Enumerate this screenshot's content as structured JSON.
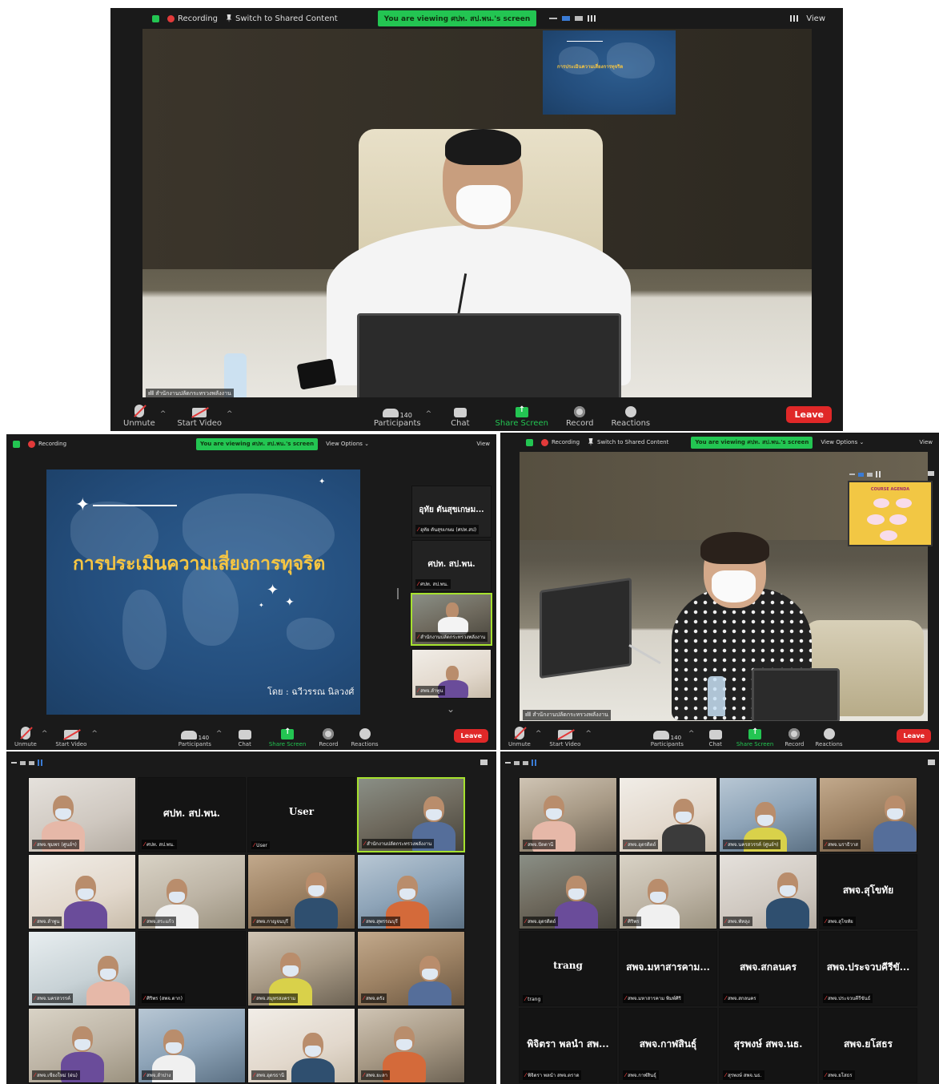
{
  "common": {
    "recording": "Recording",
    "switch_shared": "Switch to Shared Content",
    "banner": "You are viewing ศปท. สป.พน.'s screen",
    "view_options": "View Options ⌄",
    "view": "View",
    "toolbar": {
      "unmute": "Unmute",
      "start_video": "Start Video",
      "participants": "Participants",
      "participants_count": "140",
      "chat": "Chat",
      "share_screen": "Share Screen",
      "record": "Record",
      "reactions": "Reactions",
      "leave": "Leave"
    }
  },
  "panel1": {
    "name_tag": "สำนักงานปลัดกระทรวงพลังงาน"
  },
  "panel2": {
    "slide_title": "การประเมินความเสี่ยงการทุจริต",
    "slide_by": "โดย : ฉวีวรรณ นิลวงศ์",
    "side_tiles": [
      {
        "label": "อุทัย ตันสุขเกษม...",
        "tag": "อุทัย ตันสุขเกษม (ศปท.สป)"
      },
      {
        "label": "ศปท. สป.พน.",
        "tag": "ศปท. สป.พน."
      },
      {
        "label": "",
        "tag": "สำนักงานปลัดกระทรวงพลังงาน"
      },
      {
        "label": "",
        "tag": "สพจ.ลำพูน"
      }
    ]
  },
  "panel3": {
    "name_tag": "สำนักงานปลัดกระทรวงพลังงาน",
    "inset_title": "COURSE AGENDA"
  },
  "panel4": {
    "tiles": [
      {
        "label": "",
        "tag": "สพจ.ชุมพร (ศูนย์ฯ)"
      },
      {
        "label": "ศปท. สป.พน.",
        "tag": "ศปท. สป.พน."
      },
      {
        "label": "User",
        "tag": "User"
      },
      {
        "label": "",
        "tag": "สำนักงานปลัดกระทรวงพลังงาน"
      },
      {
        "label": "",
        "tag": "สพจ.ลำพูน"
      },
      {
        "label": "",
        "tag": "สพจ.สระแก้ว"
      },
      {
        "label": "",
        "tag": "สพจ.กาญจนบุรี"
      },
      {
        "label": "",
        "tag": "สพจ.สุพรรณบุรี"
      },
      {
        "label": "",
        "tag": "สพจ.นครสวรรค์"
      },
      {
        "label": "",
        "tag": "ศิริพร (สพจ.ตาก)"
      },
      {
        "label": "",
        "tag": "สพจ.สมุทรสงคราม"
      },
      {
        "label": "",
        "tag": "สพจ.ตรัง"
      },
      {
        "label": "",
        "tag": "สพจ.เชียงใหม่ (ฝน)"
      },
      {
        "label": "",
        "tag": "สพจ.ลำปาง"
      },
      {
        "label": "",
        "tag": "สพจ.อุดรธานี"
      },
      {
        "label": "",
        "tag": "สพจ.ยะลา"
      }
    ]
  },
  "panel5": {
    "tiles": [
      {
        "label": "",
        "tag": "สพจ.ปัตตานี"
      },
      {
        "label": "",
        "tag": "สพจ.อุตรดิตถ์"
      },
      {
        "label": "",
        "tag": "สพจ.นครสวรรค์ (ศูนย์ฯ)"
      },
      {
        "label": "",
        "tag": "สพจ.นราธิวาส"
      },
      {
        "label": "",
        "tag": "สพจ.อุตรดิตถ์"
      },
      {
        "label": "",
        "tag": "ศิริพร"
      },
      {
        "label": "",
        "tag": "สพจ.พัทลุง"
      },
      {
        "label": "สพจ.สุโขทัย",
        "tag": "สพจ.สุโขทัย"
      },
      {
        "label": "trang",
        "tag": "trang"
      },
      {
        "label": "สพจ.มหาสารคาม...",
        "tag": "สพจ.มหาสารคาม พิมพ์ศิริ"
      },
      {
        "label": "สพจ.สกลนคร",
        "tag": "สพจ.สกลนคร"
      },
      {
        "label": "สพจ.ประจวบคีรีขั...",
        "tag": "สพจ.ประจวบคีรีขันธ์"
      },
      {
        "label": "พิจิตรา พลนำ สพ...",
        "tag": "พิจิตรา พลนำ สพจ.ตราด"
      },
      {
        "label": "สพจ.กาฬสินธุ์",
        "tag": "สพจ.กาฬสินธุ์"
      },
      {
        "label": "สุรพงษ์ สพจ.นธ.",
        "tag": "สุรพงษ์ สพจ.นธ."
      },
      {
        "label": "สพจ.ยโสธร",
        "tag": "สพจ.ยโสธร"
      }
    ]
  }
}
